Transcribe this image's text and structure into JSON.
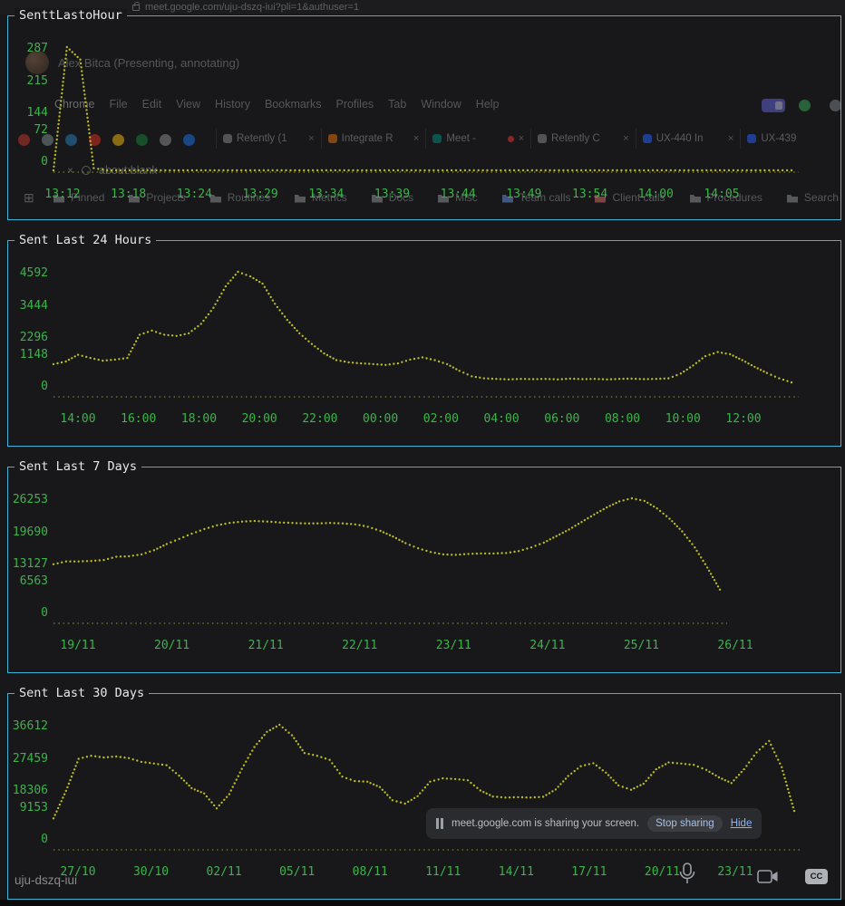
{
  "theme": {
    "background": "#18181a",
    "panel_border": "#3fb3d6",
    "axis_label_green": "#3cb44a",
    "dot_yellow": "#b9ba25",
    "title_color": "#e8e8e8"
  },
  "chart_data": [
    {
      "type": "line",
      "title": "SenttLastoHour",
      "y_ticks": [
        "287",
        "215",
        "144",
        "72",
        "0"
      ],
      "x_ticks": [
        "13:12",
        "13:18",
        "13:24",
        "13:29",
        "13:34",
        "13:39",
        "13:44",
        "13:49",
        "13:54",
        "14:00",
        "14:05"
      ],
      "ylim": [
        0,
        287
      ],
      "values": [
        0,
        287,
        258,
        5,
        0,
        0,
        0,
        0,
        0,
        0,
        0,
        0,
        0,
        0,
        0,
        0,
        0,
        0,
        0,
        0,
        0,
        0,
        0,
        0,
        0,
        0,
        0,
        0,
        0,
        0,
        0,
        0,
        0,
        0,
        0,
        0,
        0,
        0,
        0,
        0,
        0,
        0,
        0,
        0,
        0,
        0,
        0,
        0,
        0,
        0,
        0,
        0,
        0,
        0,
        0,
        0
      ]
    },
    {
      "type": "line",
      "title": "Sent Last 24 Hours",
      "y_ticks": [
        "4592",
        "3444",
        "2296",
        "1148",
        "0"
      ],
      "x_ticks": [
        "14:00",
        "16:00",
        "18:00",
        "20:00",
        "22:00",
        "00:00",
        "02:00",
        "04:00",
        "06:00",
        "08:00",
        "10:00",
        "12:00"
      ],
      "ylim": [
        0,
        4592
      ],
      "values": [
        1150,
        1250,
        1500,
        1380,
        1280,
        1320,
        1380,
        2250,
        2400,
        2250,
        2200,
        2300,
        2650,
        3250,
        4050,
        4592,
        4420,
        4150,
        3400,
        2800,
        2300,
        1900,
        1550,
        1300,
        1220,
        1180,
        1150,
        1120,
        1180,
        1320,
        1400,
        1300,
        1150,
        900,
        700,
        620,
        600,
        580,
        600,
        590,
        600,
        580,
        610,
        590,
        600,
        580,
        600,
        610,
        590,
        600,
        620,
        800,
        1100,
        1450,
        1600,
        1520,
        1300,
        1050,
        820,
        620,
        470
      ]
    },
    {
      "type": "line",
      "title": "Sent Last 7 Days",
      "y_ticks": [
        "26253",
        "19690",
        "13127",
        "6563",
        "0"
      ],
      "x_ticks": [
        "19/11",
        "20/11",
        "21/11",
        "22/11",
        "23/11",
        "24/11",
        "25/11",
        "26/11"
      ],
      "ylim": [
        0,
        26253
      ],
      "values": [
        12200,
        12800,
        12800,
        12900,
        13100,
        13800,
        13900,
        14300,
        15200,
        16500,
        17600,
        18700,
        19700,
        20500,
        21000,
        21300,
        21400,
        21300,
        21100,
        21000,
        20900,
        20900,
        21000,
        20900,
        20700,
        20200,
        19300,
        18100,
        16700,
        15600,
        14800,
        14300,
        14200,
        14400,
        14500,
        14500,
        14600,
        15000,
        15800,
        16800,
        18200,
        19600,
        21200,
        22800,
        24300,
        25600,
        26253,
        25700,
        24100,
        21900,
        19200,
        15800,
        11500,
        6800
      ]
    },
    {
      "type": "line",
      "title": "Sent Last 30 Days",
      "y_ticks": [
        "36612",
        "27459",
        "18306",
        "9153",
        "0"
      ],
      "x_ticks": [
        "27/10",
        "30/10",
        "02/11",
        "05/11",
        "08/11",
        "11/11",
        "14/11",
        "17/11",
        "20/11",
        "23/11"
      ],
      "ylim": [
        0,
        36612
      ],
      "values": [
        8800,
        17000,
        26500,
        27400,
        26900,
        27200,
        26700,
        25600,
        25100,
        24600,
        21500,
        17800,
        16200,
        11800,
        16000,
        23500,
        30000,
        34500,
        36612,
        33500,
        28200,
        27400,
        26200,
        21200,
        19900,
        19700,
        18100,
        14200,
        13200,
        15400,
        19700,
        20700,
        20500,
        20100,
        17100,
        15300,
        15000,
        15100,
        15000,
        15200,
        17400,
        21400,
        24300,
        25200,
        22400,
        18600,
        17300,
        19100,
        23400,
        25400,
        25100,
        24700,
        23200,
        21000,
        19300,
        23400,
        28400,
        31800,
        24000,
        11000
      ]
    }
  ],
  "browser": {
    "url": "meet.google.com/uju-dszq-iui?pli=1&authuser=1",
    "presenter": "Alex Bitca (Presenting, annotating)",
    "menu_items": [
      "Chrome",
      "File",
      "Edit",
      "View",
      "History",
      "Bookmarks",
      "Profiles",
      "Tab",
      "Window",
      "Help"
    ],
    "pinned_favicon_colors": [
      "#c0392b",
      "#7f8c8d",
      "#2980b9",
      "#d93025",
      "#f1b70f",
      "#188038",
      "#8e8e8e",
      "#1a73e8"
    ],
    "tabs": [
      {
        "label": "Retently (1",
        "favicon_color": "#8a8a8a",
        "recording": false,
        "closable": true
      },
      {
        "label": "Integrate R",
        "favicon_color": "#e8710a",
        "recording": false,
        "closable": true
      },
      {
        "label": "Meet -",
        "favicon_color": "#00897b",
        "recording": true,
        "closable": true
      },
      {
        "label": "Retently C",
        "favicon_color": "#8a8a8a",
        "recording": false,
        "closable": true
      },
      {
        "label": "UX-440 In",
        "favicon_color": "#2962ff",
        "recording": false,
        "closable": true
      },
      {
        "label": "UX-439",
        "favicon_color": "#2962ff",
        "recording": false,
        "closable": false
      }
    ],
    "secondary_tab": "about:blank",
    "bookmarks": [
      {
        "label": "Pinned",
        "color": "#8f9398"
      },
      {
        "label": "Projects",
        "color": "#8f9398"
      },
      {
        "label": "Routines",
        "color": "#8f9398"
      },
      {
        "label": "Metrics",
        "color": "#8f9398"
      },
      {
        "label": "Docs",
        "color": "#8f9398"
      },
      {
        "label": "Misc",
        "color": "#8f9398"
      },
      {
        "label": "Team calls",
        "color": "#6b8fd6"
      },
      {
        "label": "Client calls",
        "color": "#d66b6b"
      },
      {
        "label": "Procedures",
        "color": "#8f9398"
      },
      {
        "label": "Search",
        "color": "#8f9398"
      }
    ],
    "share_banner": {
      "message": "meet.google.com is sharing your screen.",
      "stop_label": "Stop sharing",
      "hide_label": "Hide"
    }
  },
  "meet": {
    "session_code": "uju-dszq-iui"
  }
}
